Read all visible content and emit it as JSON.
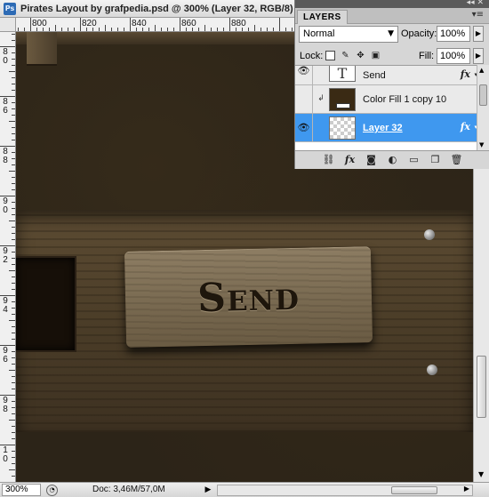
{
  "document": {
    "title": "Pirates Layout by grafpedia.psd @ 300% (Layer 32, RGB/8)",
    "app_icon": "Ps"
  },
  "rulers": {
    "horizontal": [
      "800",
      "820",
      "840",
      "860",
      "880"
    ],
    "vertical": [
      "8\n0",
      "8\n6",
      "8\n8",
      "9\n0",
      "9\n2",
      "9\n4",
      "9\n6",
      "9\n8",
      "1\n0"
    ]
  },
  "canvas": {
    "button_text": "Send"
  },
  "layers_panel": {
    "tab_label": "LAYERS",
    "menu_icon": "panel-menu-icon",
    "blend_mode": "Normal",
    "opacity_label": "Opacity:",
    "opacity_value": "100%",
    "lock_label": "Lock:",
    "fill_label": "Fill:",
    "fill_value": "100%",
    "layers": [
      {
        "name": "Send",
        "thumb": "T",
        "fx": "fx",
        "selected": false
      },
      {
        "name": "Color Fill 1 copy 10",
        "thumb": "",
        "fx": "",
        "selected": false
      },
      {
        "name": "Layer 32",
        "thumb": "",
        "fx": "fx",
        "selected": true
      }
    ]
  },
  "status_bar": {
    "zoom": "300%",
    "doc_info": "Doc: 3,46M/57,0M"
  },
  "colors": {
    "selected_layer": "#3f98ef",
    "canvas_bg": "#2c2418",
    "button_wood": "#7f7058"
  }
}
